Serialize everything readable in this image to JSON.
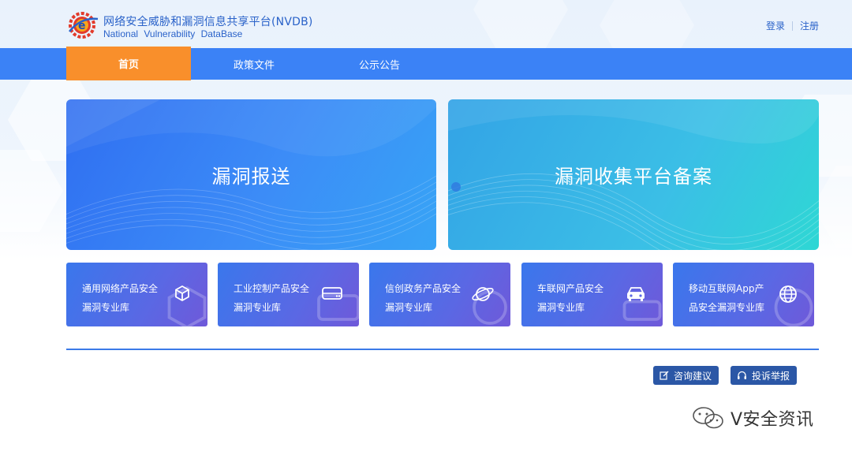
{
  "header": {
    "title_cn": "网络安全威胁和漏洞信息共享平台(NVDB)",
    "title_en": "National Vulnerability DataBase",
    "login": "登录",
    "register": "注册"
  },
  "nav": [
    {
      "label": "首页",
      "active": true
    },
    {
      "label": "政策文件",
      "active": false
    },
    {
      "label": "公示公告",
      "active": false
    }
  ],
  "hero": [
    {
      "label": "漏洞报送"
    },
    {
      "label": "漏洞收集平台备案"
    }
  ],
  "cards": [
    {
      "line1": "通用网络产品安全",
      "line2": "漏洞专业库",
      "icon": "cube-icon"
    },
    {
      "line1": "工业控制产品安全",
      "line2": "漏洞专业库",
      "icon": "server-icon"
    },
    {
      "line1": "信创政务产品安全",
      "line2": "漏洞专业库",
      "icon": "planet-icon"
    },
    {
      "line1": "车联网产品安全",
      "line2": "漏洞专业库",
      "icon": "car-icon"
    },
    {
      "line1": "移动互联网App产",
      "line2": "品安全漏洞专业库",
      "icon": "globe-icon"
    }
  ],
  "actions": {
    "consult": "咨询建议",
    "complaint": "投诉举报"
  },
  "watermark": "V安全资讯",
  "colors": {
    "nav": "#3b82f6",
    "nav_active": "#f98f2b",
    "brand_text": "#2a62c9",
    "button": "#2b57a6"
  }
}
